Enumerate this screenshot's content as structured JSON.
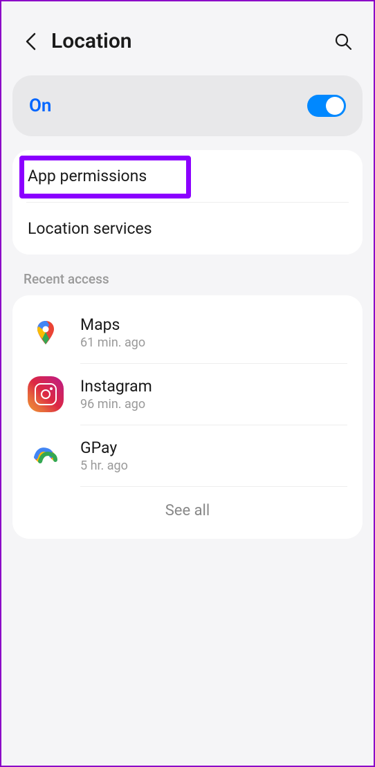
{
  "header": {
    "title": "Location"
  },
  "toggle": {
    "label": "On",
    "state": true
  },
  "settings": {
    "app_permissions": "App permissions",
    "location_services": "Location services"
  },
  "recent": {
    "section_label": "Recent access",
    "apps": [
      {
        "name": "Maps",
        "time": "61 min. ago",
        "icon": "maps"
      },
      {
        "name": "Instagram",
        "time": "96 min. ago",
        "icon": "instagram"
      },
      {
        "name": "GPay",
        "time": "5 hr. ago",
        "icon": "gpay"
      }
    ],
    "see_all": "See all"
  }
}
